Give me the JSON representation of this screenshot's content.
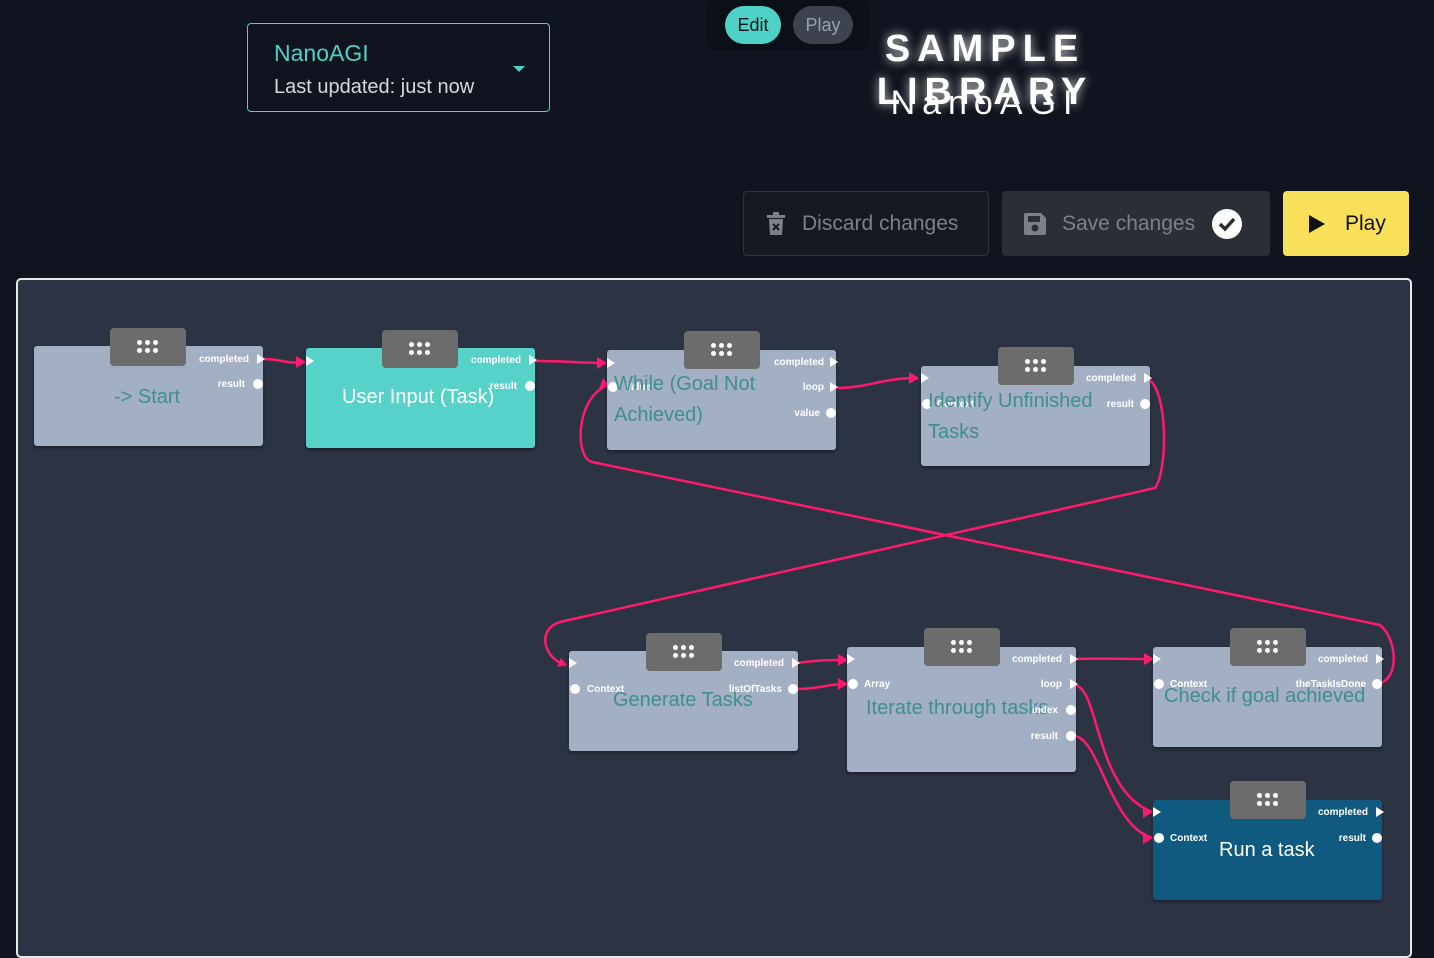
{
  "selector": {
    "name": "NanoAGI",
    "updated": "Last updated: just now"
  },
  "mode": {
    "edit": "Edit",
    "play": "Play"
  },
  "header": {
    "title": "SAMPLE LIBRARY",
    "subtitle": "NanoAGI"
  },
  "toolbar": {
    "discard": "Discard changes",
    "save": "Save changes",
    "play": "Play"
  },
  "colors": {
    "accent": "#4fd1c5",
    "wire": "#ff1a6e",
    "play": "#f8e05a",
    "run_task": "#0f5a7e"
  },
  "nodes": {
    "start": {
      "label": "-> Start",
      "completed": "completed",
      "result": "result"
    },
    "user_input": {
      "label": "User Input (Task)",
      "completed": "completed",
      "result": "result"
    },
    "while": {
      "label": "While (Goal Not Achieved)",
      "value_in": "Value",
      "completed": "completed",
      "loop": "loop",
      "value": "value"
    },
    "identify": {
      "label": "Identify Unfinished Tasks",
      "context": "Context",
      "completed": "completed",
      "result": "result"
    },
    "generate": {
      "label": "Generate Tasks",
      "context": "Context",
      "completed": "completed",
      "list": "listOfTasks"
    },
    "iterate": {
      "label": "Iterate through tasks",
      "array": "Array",
      "completed": "completed",
      "loop": "loop",
      "index": "index",
      "result": "result"
    },
    "check": {
      "label": "Check if goal achieved",
      "context": "Context",
      "completed": "completed",
      "done": "theTaskIsDone"
    },
    "run": {
      "label": "Run a task",
      "context": "Context",
      "completed": "completed",
      "result": "result"
    }
  }
}
